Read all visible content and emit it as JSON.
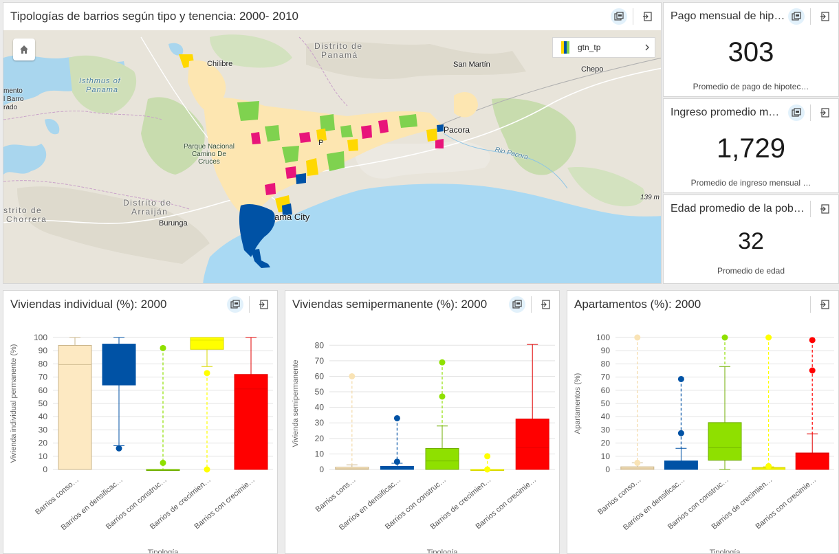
{
  "map_panel": {
    "title": "Tipologías de barrios según tipo y tenencia: 2000- 2010",
    "legend_layer": "gtn_tp",
    "labels": {
      "chilibre": "Chilibre",
      "distrito_panama_1": "Distrito de",
      "distrito_panama_2": "Panamá",
      "san_martin": "San Martín",
      "chepo": "Chepo",
      "isthmus_1": "Isthmus of",
      "isthmus_2": "Panama",
      "mento": "mento",
      "barro": "l Barro",
      "rado": "rado",
      "park_1": "Parque Nacional",
      "park_2": "Camino De",
      "park_3": "Cruces",
      "pacora": "Pacora",
      "rio_pacora": "Rio Pacora",
      "arraijan_1": "Distrito de",
      "arraijan_2": "Arraiján",
      "chorrera_1": "strito de",
      "chorrera_2": "Chorrera",
      "burunga": "Burunga",
      "panama_city": "ama City",
      "scale": "139 m",
      "p_label": "P"
    }
  },
  "indicators": [
    {
      "title": "Pago mensual de hip…",
      "value": "303",
      "description": "Promedio de pago de hipotec…"
    },
    {
      "title": "Ingreso promedio m…",
      "value": "1,729",
      "description": "Promedio de ingreso mensual …"
    },
    {
      "title": "Edad promedio de la pob…",
      "value": "32",
      "description": "Promedio de edad"
    }
  ],
  "colors": {
    "consolidados": "#fde9c2",
    "densificacion": "#0052a5",
    "construccion": "#8fe000",
    "crecimiento_sin": "#ffff00",
    "crecimiento_con": "#ff0000"
  },
  "icons": {
    "focus": "focus-mode-icon",
    "export": "export-icon",
    "home": "home-icon",
    "chevron": "chevron-right-icon"
  },
  "chart_data": [
    {
      "type": "boxplot",
      "title": "Viviendas individual (%): 2000",
      "ylabel": "Vivienda individual permanente (%)",
      "xlabel": "Tipología",
      "ylim": [
        0,
        100
      ],
      "yticks": [
        0,
        10,
        20,
        30,
        40,
        50,
        60,
        70,
        80,
        90,
        100
      ],
      "categories": [
        "Barrios conso…",
        "Barrios en densificac…",
        "Barrios con construc…",
        "Barrios de crecimien…",
        "Barrios con crecimie…"
      ],
      "series": [
        {
          "min": 0,
          "q1": 0,
          "median": 79.5,
          "q3": 94,
          "max": 100,
          "outliers": []
        },
        {
          "min": 18,
          "q1": 64,
          "median": 87,
          "q3": 95,
          "max": 100,
          "outliers": [
            16
          ]
        },
        {
          "min": 0,
          "q1": 0,
          "median": 0,
          "q3": 0,
          "max": 0,
          "outliers": [
            5,
            92
          ]
        },
        {
          "min": 78,
          "q1": 91,
          "median": 98,
          "q3": 100,
          "max": 100,
          "outliers": [
            0,
            73
          ]
        },
        {
          "min": 0,
          "q1": 0,
          "median": 61,
          "q3": 72,
          "max": 100,
          "outliers": []
        }
      ]
    },
    {
      "type": "boxplot",
      "title": "Viviendas semipermanente (%): 2000",
      "ylabel": "Vivienda semipermanente",
      "xlabel": "Tipología",
      "ylim": [
        0,
        85
      ],
      "yticks": [
        0,
        10,
        20,
        30,
        40,
        50,
        60,
        70,
        80
      ],
      "categories": [
        "Barrios cons…",
        "Barrios en densificac…",
        "Barrios con construc…",
        "Barrios de crecimien…",
        "Barrios con crecimie…"
      ],
      "series": [
        {
          "min": 0,
          "q1": 0,
          "median": 0.5,
          "q3": 1.5,
          "max": 3,
          "outliers": [
            60
          ]
        },
        {
          "min": 0,
          "q1": 0,
          "median": 1,
          "q3": 2,
          "max": 4,
          "outliers": [
            5,
            33
          ]
        },
        {
          "min": 0,
          "q1": 0,
          "median": 5.5,
          "q3": 13.5,
          "max": 28,
          "outliers": [
            47,
            69
          ]
        },
        {
          "min": 0,
          "q1": 0,
          "median": 0,
          "q3": 0,
          "max": 0,
          "outliers": [
            0,
            8.5
          ]
        },
        {
          "min": 0,
          "q1": 0,
          "median": 14,
          "q3": 32.5,
          "max": 80.5,
          "outliers": []
        }
      ]
    },
    {
      "type": "boxplot",
      "title": "Apartamentos (%): 2000",
      "ylabel": "Apartamentos (%)",
      "xlabel": "Tipología",
      "ylim": [
        0,
        100
      ],
      "yticks": [
        0,
        10,
        20,
        30,
        40,
        50,
        60,
        70,
        80,
        90,
        100
      ],
      "categories": [
        "Barrios conso…",
        "Barrios en densificac…",
        "Barrios con construc…",
        "Barrios de crecimien…",
        "Barrios con crecimie…"
      ],
      "series": [
        {
          "min": 0,
          "q1": 0,
          "median": 1,
          "q3": 2,
          "max": 5,
          "outliers": [
            5,
            100
          ]
        },
        {
          "min": 0,
          "q1": 0,
          "median": 6,
          "q3": 6.5,
          "max": 16,
          "outliers": [
            27.5,
            68.5
          ]
        },
        {
          "min": 0,
          "q1": 7,
          "median": 16.5,
          "q3": 35.5,
          "max": 78,
          "outliers": [
            100
          ]
        },
        {
          "min": 0,
          "q1": 0,
          "median": 1,
          "q3": 1.5,
          "max": 2,
          "outliers": [
            2.5,
            100
          ]
        },
        {
          "min": 0,
          "q1": 0,
          "median": 12,
          "q3": 12.5,
          "max": 27,
          "outliers": [
            75,
            98
          ]
        }
      ]
    }
  ]
}
